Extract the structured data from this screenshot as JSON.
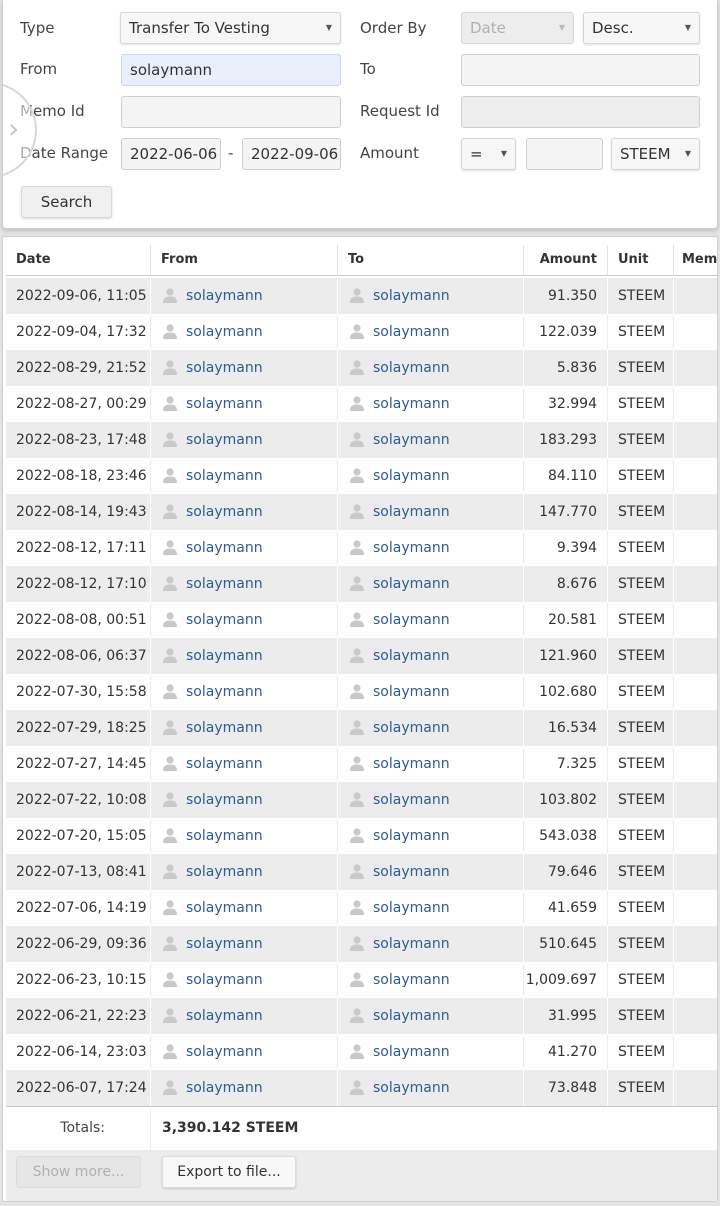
{
  "filters": {
    "type_label": "Type",
    "type_value": "Transfer To Vesting",
    "order_by_label": "Order By",
    "order_by_field": "Date",
    "order_direction": "Desc.",
    "from_label": "From",
    "from_value": "solaymann",
    "to_label": "To",
    "to_value": "",
    "memo_id_label": "Memo Id",
    "memo_id_value": "",
    "request_id_label": "Request Id",
    "request_id_value": "",
    "date_range_label": "Date Range",
    "date_from": "2022-06-06",
    "date_separator": "-",
    "date_to": "2022-09-06",
    "amount_label": "Amount",
    "amount_operator": "=",
    "amount_value": "",
    "amount_unit": "STEEM",
    "search_button": "Search"
  },
  "table": {
    "headers": {
      "date": "Date",
      "from": "From",
      "to": "To",
      "amount": "Amount",
      "unit": "Unit",
      "memo": "Mem"
    },
    "rows": [
      {
        "date": "2022-09-06, 11:05",
        "from": "solaymann",
        "to": "solaymann",
        "amount": "91.350",
        "unit": "STEEM"
      },
      {
        "date": "2022-09-04, 17:32",
        "from": "solaymann",
        "to": "solaymann",
        "amount": "122.039",
        "unit": "STEEM"
      },
      {
        "date": "2022-08-29, 21:52",
        "from": "solaymann",
        "to": "solaymann",
        "amount": "5.836",
        "unit": "STEEM"
      },
      {
        "date": "2022-08-27, 00:29",
        "from": "solaymann",
        "to": "solaymann",
        "amount": "32.994",
        "unit": "STEEM"
      },
      {
        "date": "2022-08-23, 17:48",
        "from": "solaymann",
        "to": "solaymann",
        "amount": "183.293",
        "unit": "STEEM"
      },
      {
        "date": "2022-08-18, 23:46",
        "from": "solaymann",
        "to": "solaymann",
        "amount": "84.110",
        "unit": "STEEM"
      },
      {
        "date": "2022-08-14, 19:43",
        "from": "solaymann",
        "to": "solaymann",
        "amount": "147.770",
        "unit": "STEEM"
      },
      {
        "date": "2022-08-12, 17:11",
        "from": "solaymann",
        "to": "solaymann",
        "amount": "9.394",
        "unit": "STEEM"
      },
      {
        "date": "2022-08-12, 17:10",
        "from": "solaymann",
        "to": "solaymann",
        "amount": "8.676",
        "unit": "STEEM"
      },
      {
        "date": "2022-08-08, 00:51",
        "from": "solaymann",
        "to": "solaymann",
        "amount": "20.581",
        "unit": "STEEM"
      },
      {
        "date": "2022-08-06, 06:37",
        "from": "solaymann",
        "to": "solaymann",
        "amount": "121.960",
        "unit": "STEEM"
      },
      {
        "date": "2022-07-30, 15:58",
        "from": "solaymann",
        "to": "solaymann",
        "amount": "102.680",
        "unit": "STEEM"
      },
      {
        "date": "2022-07-29, 18:25",
        "from": "solaymann",
        "to": "solaymann",
        "amount": "16.534",
        "unit": "STEEM"
      },
      {
        "date": "2022-07-27, 14:45",
        "from": "solaymann",
        "to": "solaymann",
        "amount": "7.325",
        "unit": "STEEM"
      },
      {
        "date": "2022-07-22, 10:08",
        "from": "solaymann",
        "to": "solaymann",
        "amount": "103.802",
        "unit": "STEEM"
      },
      {
        "date": "2022-07-20, 15:05",
        "from": "solaymann",
        "to": "solaymann",
        "amount": "543.038",
        "unit": "STEEM"
      },
      {
        "date": "2022-07-13, 08:41",
        "from": "solaymann",
        "to": "solaymann",
        "amount": "79.646",
        "unit": "STEEM"
      },
      {
        "date": "2022-07-06, 14:19",
        "from": "solaymann",
        "to": "solaymann",
        "amount": "41.659",
        "unit": "STEEM"
      },
      {
        "date": "2022-06-29, 09:36",
        "from": "solaymann",
        "to": "solaymann",
        "amount": "510.645",
        "unit": "STEEM"
      },
      {
        "date": "2022-06-23, 10:15",
        "from": "solaymann",
        "to": "solaymann",
        "amount": "1,009.697",
        "unit": "STEEM"
      },
      {
        "date": "2022-06-21, 22:23",
        "from": "solaymann",
        "to": "solaymann",
        "amount": "31.995",
        "unit": "STEEM"
      },
      {
        "date": "2022-06-14, 23:03",
        "from": "solaymann",
        "to": "solaymann",
        "amount": "41.270",
        "unit": "STEEM"
      },
      {
        "date": "2022-06-07, 17:24",
        "from": "solaymann",
        "to": "solaymann",
        "amount": "73.848",
        "unit": "STEEM"
      }
    ],
    "totals_label": "Totals:",
    "totals_value": "3,390.142 STEEM",
    "show_more_button": "Show more...",
    "export_button": "Export to file..."
  },
  "icons": {
    "user": "user-icon",
    "side_toggle": "chevron-right-icon"
  },
  "colors": {
    "link": "#2b5c9a",
    "row_alt": "#ececec",
    "active_field": "#e9f0fc"
  }
}
